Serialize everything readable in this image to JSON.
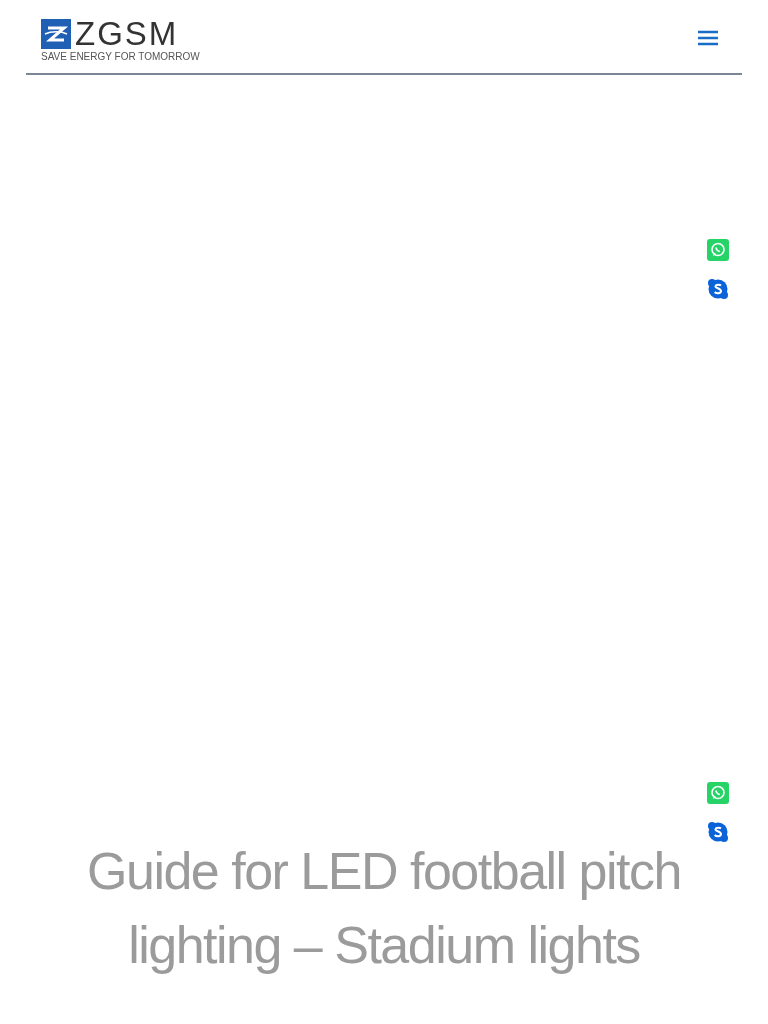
{
  "header": {
    "logo_name": "ZGSM",
    "logo_tagline": "SAVE ENERGY FOR TOMORROW"
  },
  "contact_groups": [
    {
      "kind": "pair"
    },
    {
      "kind": "pair"
    }
  ],
  "title": "Guide for LED football pitch lighting – Stadium lights"
}
